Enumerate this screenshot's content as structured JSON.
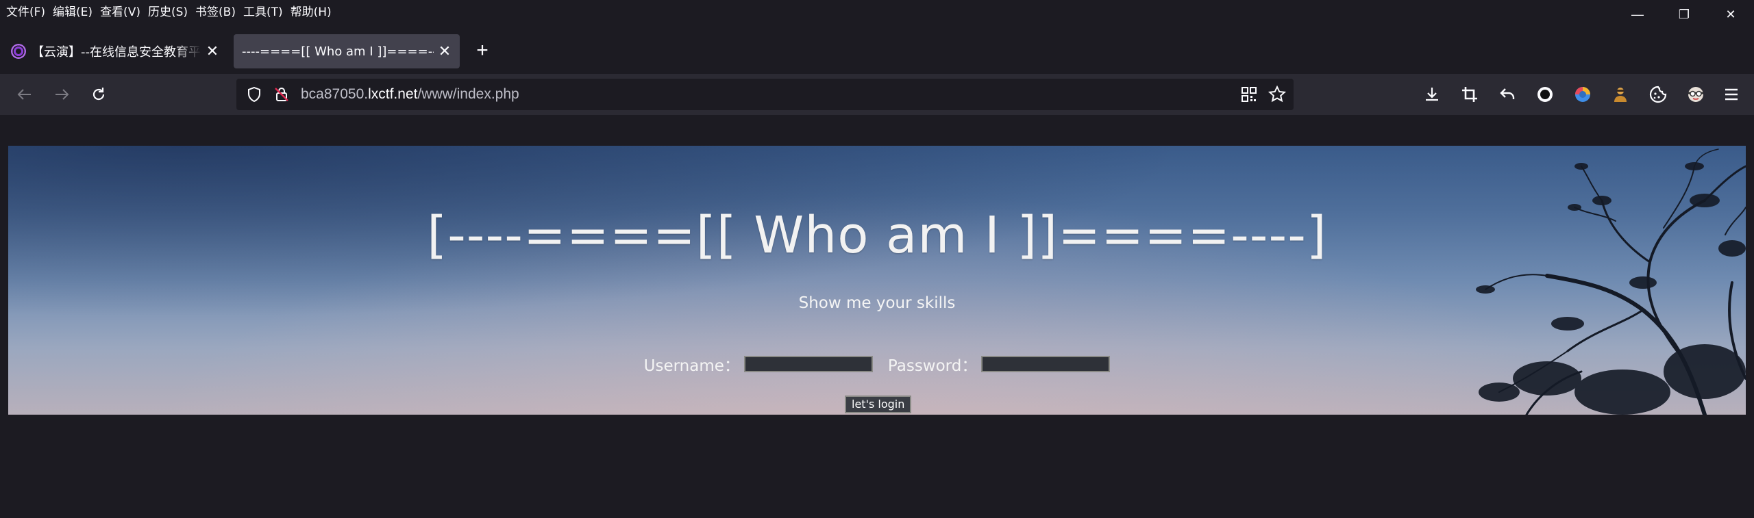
{
  "menu": [
    "文件(F)",
    "编辑(E)",
    "查看(V)",
    "历史(S)",
    "书签(B)",
    "工具(T)",
    "帮助(H)"
  ],
  "window_controls": {
    "minimize": "—",
    "restore": "❐",
    "close": "✕"
  },
  "tabs": [
    {
      "title": "【云演】--在线信息安全教育平",
      "close": "✕",
      "active": false
    },
    {
      "title": "----====[[ Who am I ]]====----",
      "close": "✕",
      "active": true
    }
  ],
  "new_tab_label": "+",
  "url": {
    "domain_prefix": "bca87050.",
    "domain_main": "lxctf.net",
    "path": "/www/index.php"
  },
  "toolbar_icons": [
    "download-icon",
    "crop-icon",
    "undo-icon",
    "circle-icon",
    "extension-shield-icon",
    "extension-person-icon",
    "cookie-icon",
    "extension-face-icon",
    "menu-icon"
  ],
  "page": {
    "title": "[----====[[ Who am I ]]====----]",
    "subtitle": "Show me your skills",
    "username_label": "Username：",
    "password_label": "Password：",
    "login_button": "let's login"
  },
  "colors": {
    "chrome_bg": "#1c1b22",
    "toolbar_bg": "#2b2a33",
    "active_tab": "#42414d",
    "sky_top": "#3a5b8a",
    "sky_bottom": "#b8b0bb"
  }
}
